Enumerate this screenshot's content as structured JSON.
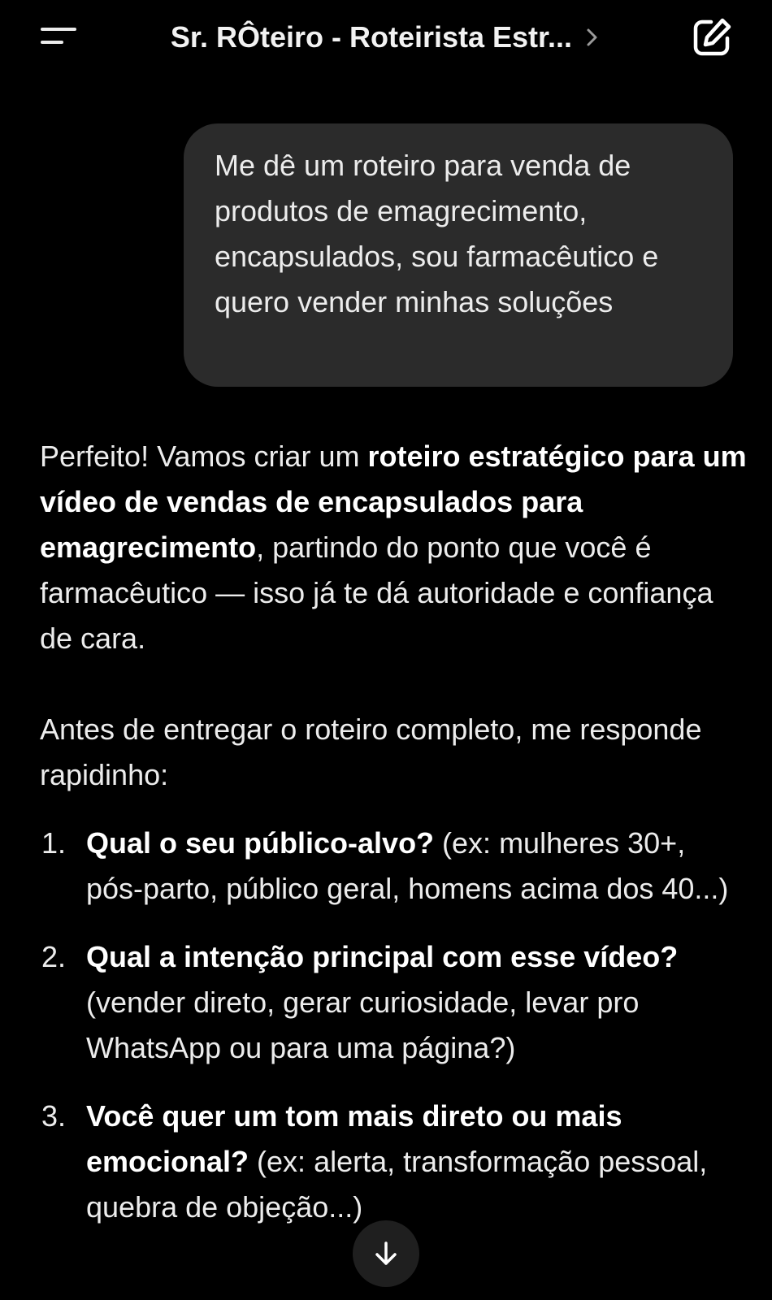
{
  "header": {
    "title": "Sr. RÔteiro - Roteirista Estr...",
    "menu_icon": "hamburger-menu-icon",
    "chevron_icon": "chevron-right-icon",
    "new_chat_icon": "new-chat-edit-icon"
  },
  "user_message": {
    "text": "Me dê um roteiro para venda de produtos de emagrecimento, encapsulados, sou farmacêutico e quero vender minhas soluções"
  },
  "assistant_message": {
    "intro_plain_1": "Perfeito! Vamos criar um ",
    "intro_bold": "roteiro estratégico para um vídeo de vendas de encapsulados para emagrecimento",
    "intro_plain_2": ", partindo do ponto que você é farmacêutico — isso já te dá autoridade e confiança de cara.",
    "question_lead": "Antes de entregar o roteiro completo, me responde rapidinho:",
    "questions": [
      {
        "number": "1.",
        "bold": "Qual o seu público-alvo?",
        "detail": " (ex: mulheres 30+, pós-parto, público geral, homens acima dos 40...)"
      },
      {
        "number": "2.",
        "bold": "Qual a intenção principal com esse vídeo?",
        "detail": " (vender direto, gerar curiosidade, levar pro WhatsApp ou para uma página?)"
      },
      {
        "number": "3.",
        "bold": "Você quer um tom mais direto ou mais emocional?",
        "detail": " (ex: alerta, transformação pessoal, quebra de objeção...)"
      }
    ]
  },
  "scroll_button": {
    "icon": "arrow-down-icon"
  },
  "colors": {
    "background": "#000000",
    "bubble": "#2b2b2b",
    "text": "#ececec",
    "scroll_button": "#1f1f1f"
  }
}
